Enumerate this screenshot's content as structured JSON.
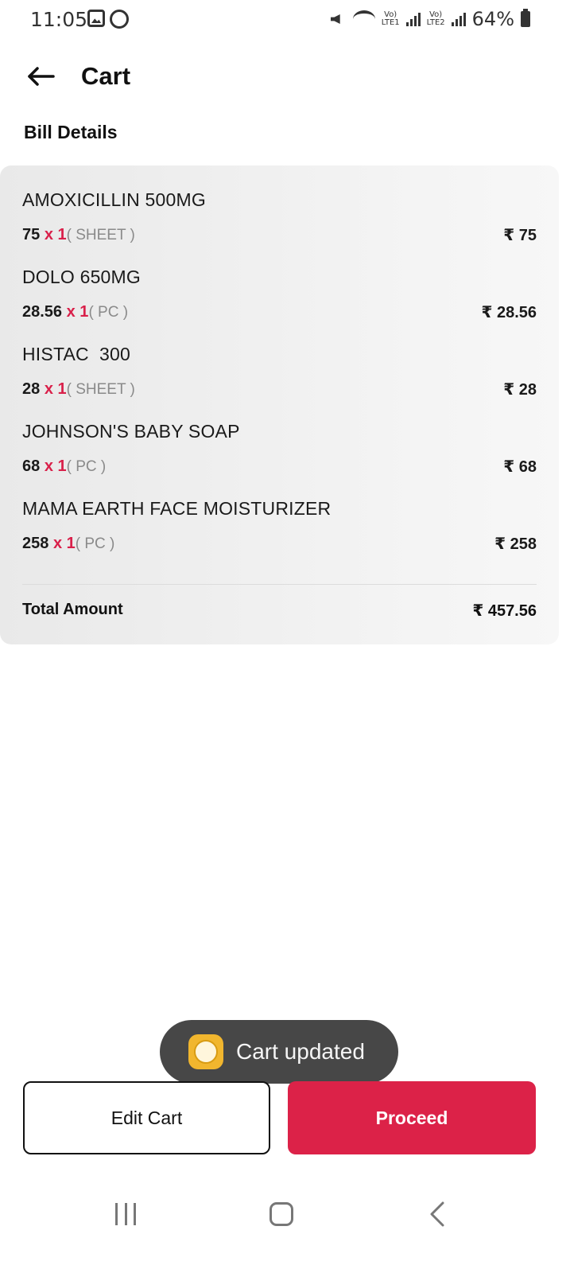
{
  "status_bar": {
    "time": "11:05",
    "sim1_label": "Vo)",
    "sim1_sub": "LTE1",
    "sim2_label": "Vo)",
    "sim2_sub": "LTE2",
    "battery": "64%"
  },
  "header": {
    "title": "Cart"
  },
  "bill": {
    "heading": "Bill Details",
    "items": [
      {
        "name": "AMOXICILLIN 500MG",
        "price": "75",
        "qty": "x 1",
        "unit": "( SHEET )",
        "total": "₹ 75"
      },
      {
        "name": "DOLO 650MG",
        "price": "28.56",
        "qty": "x 1",
        "unit": "( PC )",
        "total": "₹ 28.56"
      },
      {
        "name": "HISTAC  300",
        "price": "28",
        "qty": "x 1",
        "unit": "( SHEET )",
        "total": "₹ 28"
      },
      {
        "name": "JOHNSON'S BABY SOAP",
        "price": "68",
        "qty": "x 1",
        "unit": "( PC )",
        "total": "₹ 68"
      },
      {
        "name": "MAMA EARTH FACE MOISTURIZER",
        "price": "258",
        "qty": "x 1",
        "unit": "( PC )",
        "total": "₹ 258"
      }
    ],
    "total_label": "Total Amount",
    "total_value": "₹ 457.56"
  },
  "toast": {
    "text": "Cart updated"
  },
  "actions": {
    "edit_label": "Edit Cart",
    "proceed_label": "Proceed"
  },
  "colors": {
    "accent": "#dc2248",
    "toast_bg": "#474747"
  }
}
